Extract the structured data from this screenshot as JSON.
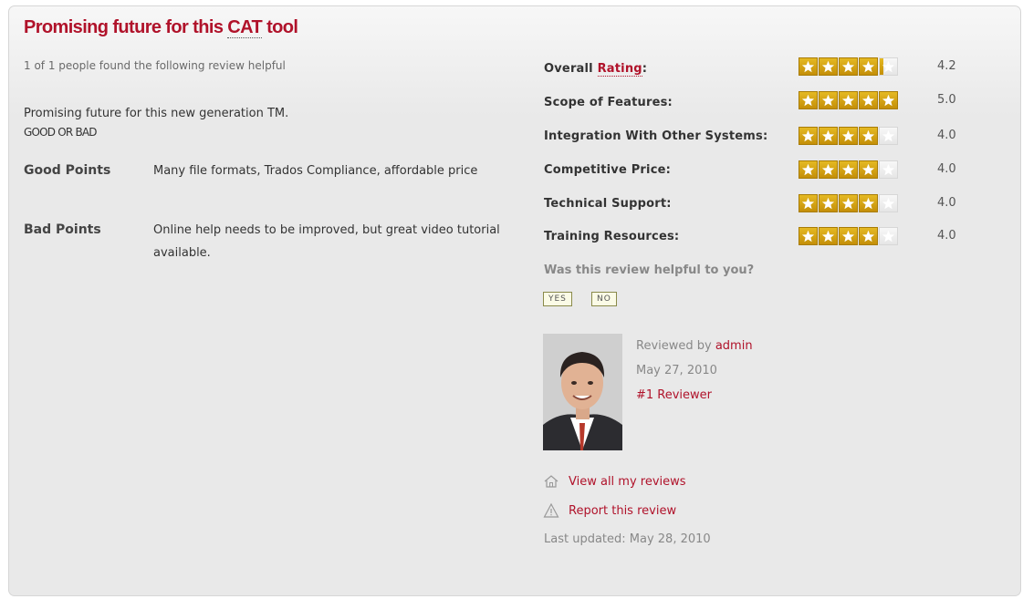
{
  "review": {
    "title_pre": "Promising future for this ",
    "title_abbr": "CAT",
    "title_post": " tool",
    "helpful_count": "1 of 1 people found the following review helpful",
    "summary": "Promising future for this new generation TM.",
    "summary_tag": "GOOD OR BAD",
    "good_label": "Good Points",
    "good_text": "Many file formats, Trados Compliance, affordable price",
    "bad_label": "Bad Points",
    "bad_text": "Online help needs to be improved, but great video tutorial available."
  },
  "ratings": [
    {
      "label_pre": "Overall ",
      "label_link": "Rating",
      "label_post": ":",
      "score": "4.2",
      "value": 4.2
    },
    {
      "label": "Scope of Features:",
      "score": "5.0",
      "value": 5
    },
    {
      "label": "Integration With Other Systems:",
      "score": "4.0",
      "value": 4
    },
    {
      "label": "Competitive Price:",
      "score": "4.0",
      "value": 4
    },
    {
      "label": "Technical Support:",
      "score": "4.0",
      "value": 4
    },
    {
      "label": "Training Resources:",
      "score": "4.0",
      "value": 4
    }
  ],
  "feedback": {
    "question": "Was this review helpful to you?",
    "yes": "YES",
    "no": "NO"
  },
  "reviewer": {
    "prefix": "Reviewed by ",
    "name": "admin",
    "date": "May 27, 2010",
    "rank": "#1 Reviewer"
  },
  "links": {
    "view_all": "View all my reviews",
    "report": "Report this review"
  },
  "last_updated": "Last updated: May 28, 2010",
  "colors": {
    "accent": "#b0122a",
    "star": "#d4a417",
    "star_empty": "#efefef",
    "panel": "#e9e9e9"
  },
  "icons": [
    "home-icon",
    "warning-icon",
    "star-icon"
  ]
}
